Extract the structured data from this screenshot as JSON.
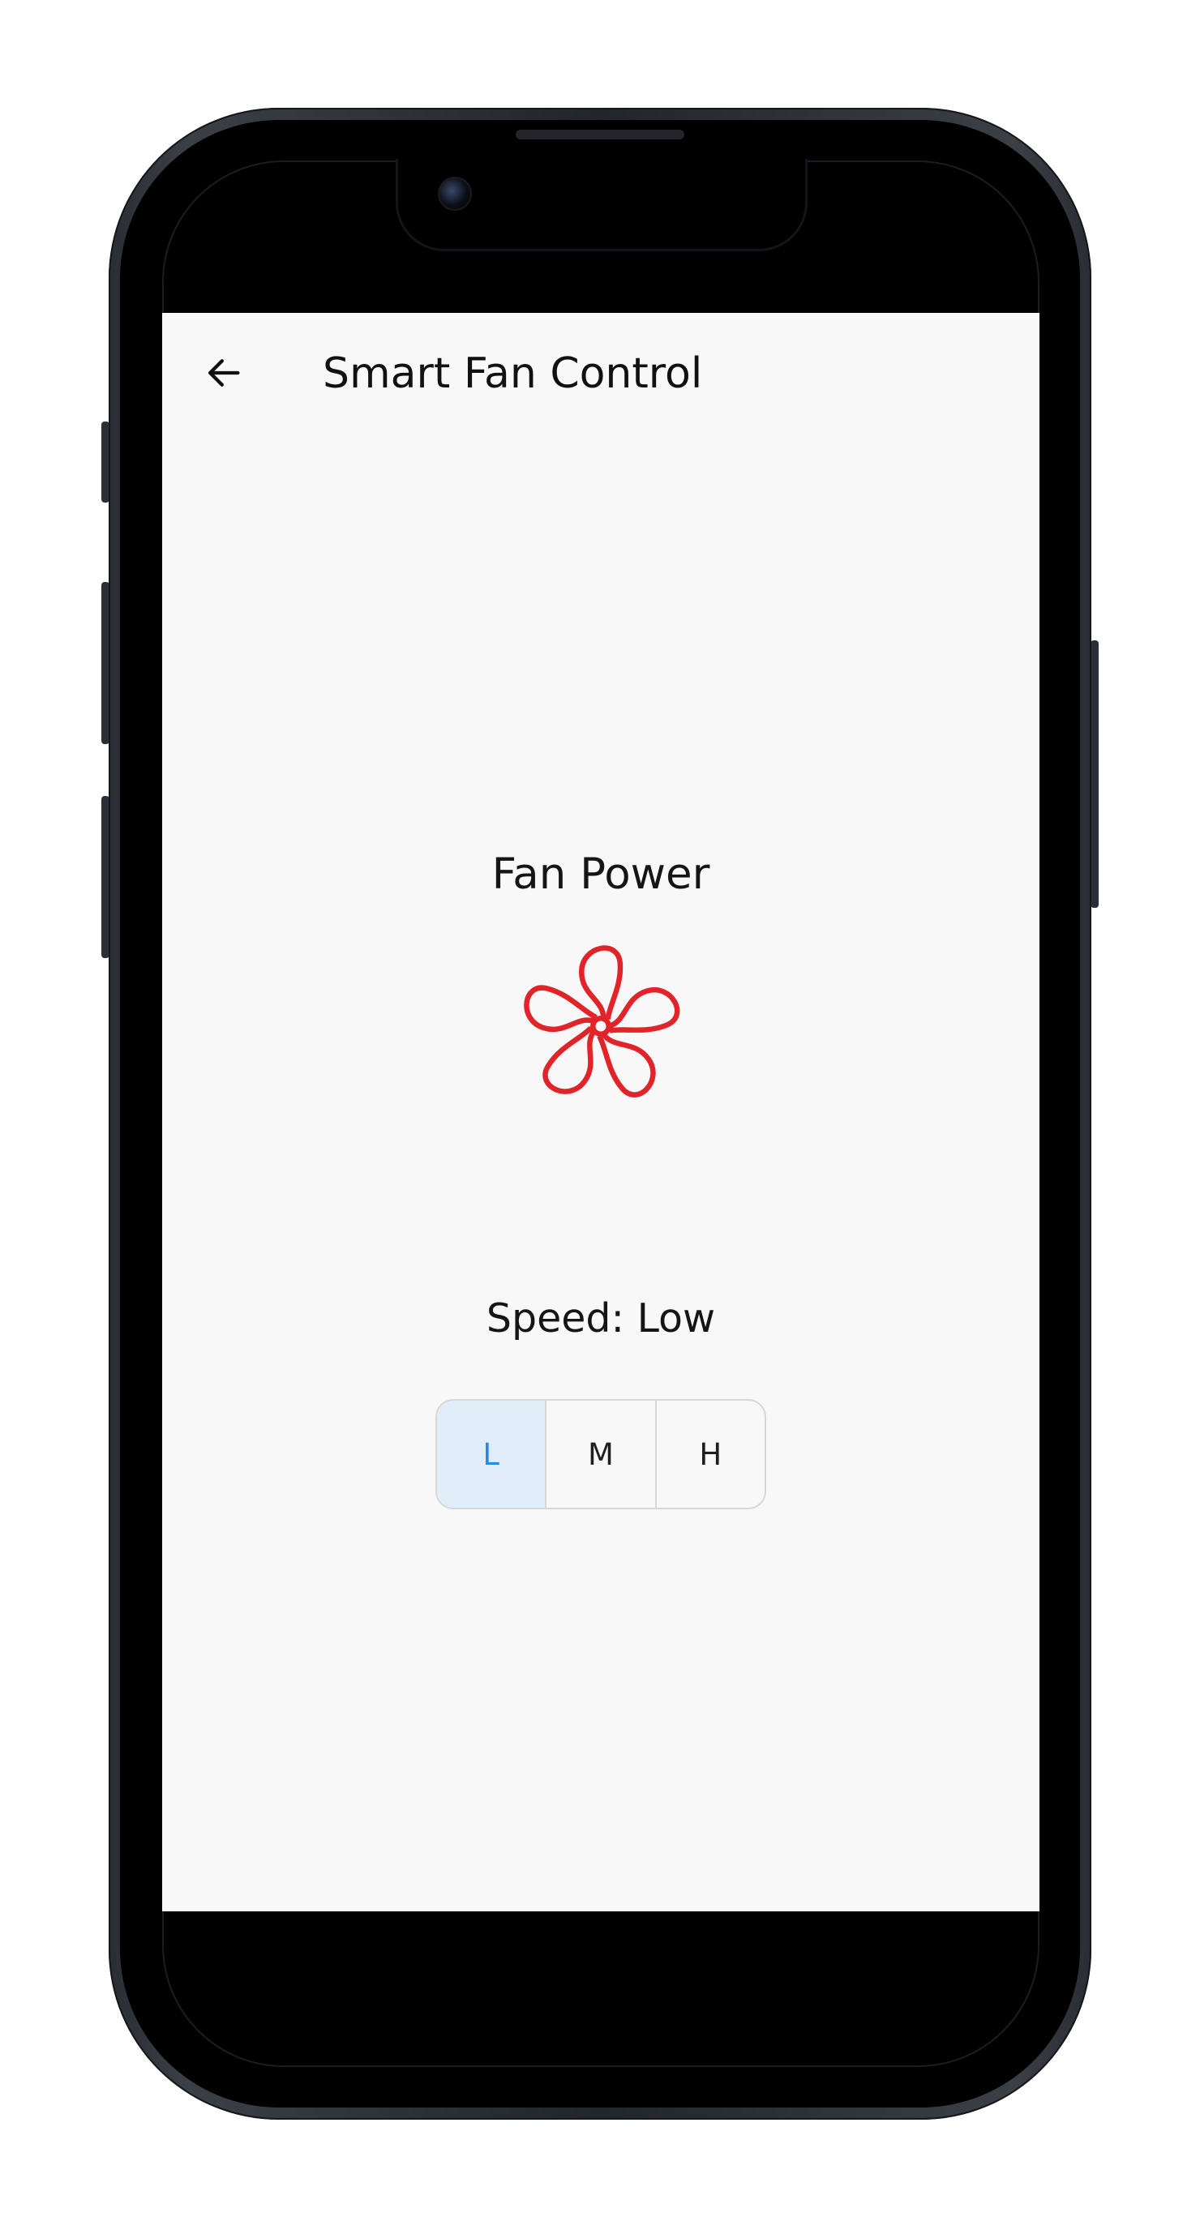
{
  "app_bar": {
    "title": "Smart Fan Control",
    "back_icon": "arrow-left-icon"
  },
  "fan": {
    "label": "Fan Power",
    "icon": "fan-icon",
    "icon_color": "#e0242a",
    "state": "on"
  },
  "speed": {
    "label": "Speed: Low",
    "options": [
      "L",
      "M",
      "H"
    ],
    "selected": "L",
    "selected_bg": "#e1edf8",
    "selected_color": "#2a8ae0"
  }
}
